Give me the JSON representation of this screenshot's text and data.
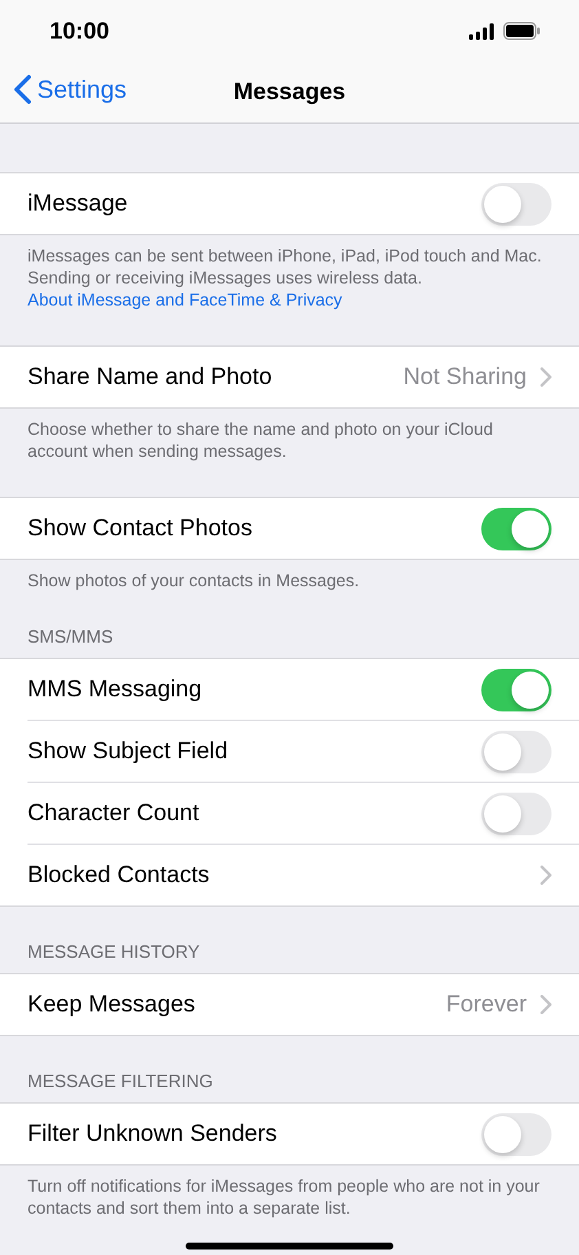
{
  "status_bar": {
    "time": "10:00"
  },
  "nav": {
    "back": "Settings",
    "title": "Messages"
  },
  "sections": [
    {
      "rows": [
        {
          "kind": "toggle",
          "label": "iMessage",
          "on": false
        }
      ],
      "footer": "iMessages can be sent between iPhone, iPad, iPod touch and Mac. Sending or receiving iMessages uses wireless data.",
      "footer_link": "About iMessage and FaceTime & Privacy"
    },
    {
      "rows": [
        {
          "kind": "value",
          "label": "Share Name and Photo",
          "value": "Not Sharing"
        }
      ],
      "footer": "Choose whether to share the name and photo on your iCloud account when sending messages."
    },
    {
      "rows": [
        {
          "kind": "toggle",
          "label": "Show Contact Photos",
          "on": true
        }
      ],
      "footer": "Show photos of your contacts in Messages."
    },
    {
      "header": "SMS/MMS",
      "rows": [
        {
          "kind": "toggle",
          "label": "MMS Messaging",
          "on": true
        },
        {
          "kind": "toggle",
          "label": "Show Subject Field",
          "on": false
        },
        {
          "kind": "toggle",
          "label": "Character Count",
          "on": false
        },
        {
          "kind": "link",
          "label": "Blocked Contacts"
        }
      ]
    },
    {
      "header": "MESSAGE HISTORY",
      "rows": [
        {
          "kind": "value",
          "label": "Keep Messages",
          "value": "Forever"
        }
      ]
    },
    {
      "header": "MESSAGE FILTERING",
      "rows": [
        {
          "kind": "toggle",
          "label": "Filter Unknown Senders",
          "on": false
        }
      ],
      "footer": "Turn off notifications for iMessages from people who are not in your contacts and sort them into a separate list."
    }
  ]
}
